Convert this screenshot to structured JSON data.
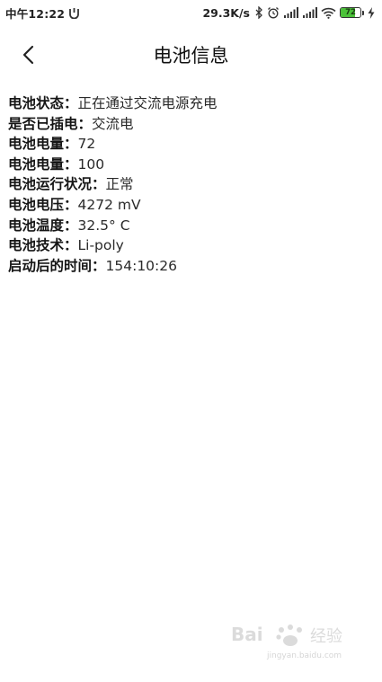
{
  "status_bar": {
    "time": "中午12:22",
    "net_speed": "29.3K/s",
    "battery_level": "72",
    "battery_fraction": 0.72,
    "left_icon": "notification-app-icon",
    "right_icons": [
      "bluetooth-icon",
      "alarm-icon",
      "signal-icon",
      "signal-icon",
      "wifi-icon",
      "battery-icon",
      "charging-bolt-icon"
    ]
  },
  "header": {
    "title": "电池信息",
    "back_icon": "chevron-left-icon"
  },
  "battery_info": [
    {
      "label": "电池状态：",
      "value": "正在通过交流电源充电"
    },
    {
      "label": "是否已插电：",
      "value": "交流电"
    },
    {
      "label": "电池电量：",
      "value": "72"
    },
    {
      "label": "电池电量：",
      "value": "100"
    },
    {
      "label": "电池运行状况：",
      "value": "正常"
    },
    {
      "label": "电池电压：",
      "value": "4272 mV"
    },
    {
      "label": "电池温度：",
      "value": "32.5° C"
    },
    {
      "label": "电池技术：",
      "value": "Li-poly"
    },
    {
      "label": "启动后的时间：",
      "value": "154:10:26"
    }
  ],
  "watermark": {
    "text": "jingyan.baidu.com"
  }
}
